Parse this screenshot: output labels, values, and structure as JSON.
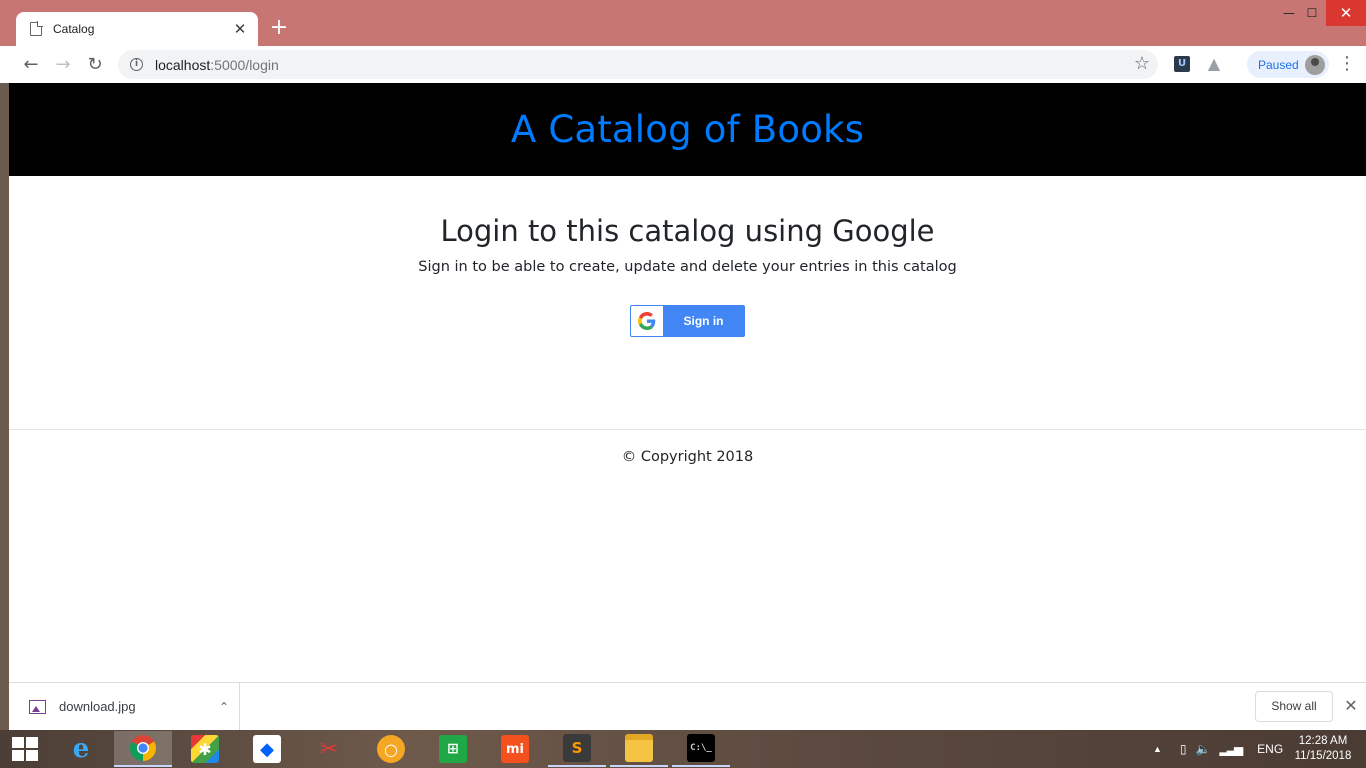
{
  "browser": {
    "tab_title": "Catalog",
    "tab_close_glyph": "✕",
    "new_tab_glyph": "+",
    "url_host": "localhost",
    "url_path": ":5000/login",
    "profile_status": "Paused",
    "window_controls": {
      "minimize": "—",
      "maximize": "☐",
      "close": "✕"
    },
    "nav": {
      "back": "←",
      "forward": "→",
      "reload": "↻"
    },
    "star_glyph": "☆",
    "menu_glyph": "⋮"
  },
  "page": {
    "site_title": "A Catalog of Books",
    "heading": "Login to this catalog using Google",
    "subtext": "Sign in to be able to create, update and delete your entries in this catalog",
    "signin_button_label": "Sign in",
    "copyright": "© Copyright 2018",
    "colors": {
      "header_bg": "#000000",
      "title": "#007bff",
      "google_blue": "#4285f4"
    }
  },
  "downloads": {
    "file_name": "download.jpg",
    "show_all_label": "Show all",
    "close_glyph": "✕",
    "caret_glyph": "⌃"
  },
  "taskbar": {
    "apps": [
      {
        "name": "internet-explorer-icon"
      },
      {
        "name": "chrome-icon"
      },
      {
        "name": "puzzle-app-icon"
      },
      {
        "name": "dropbox-icon"
      },
      {
        "name": "snipping-tool-icon"
      },
      {
        "name": "circle-app-icon"
      },
      {
        "name": "store-icon"
      },
      {
        "name": "mi-icon"
      },
      {
        "name": "sublime-text-icon"
      },
      {
        "name": "file-explorer-icon"
      },
      {
        "name": "command-prompt-icon"
      }
    ],
    "language": "ENG",
    "time": "12:28 AM",
    "date": "11/15/2018"
  }
}
